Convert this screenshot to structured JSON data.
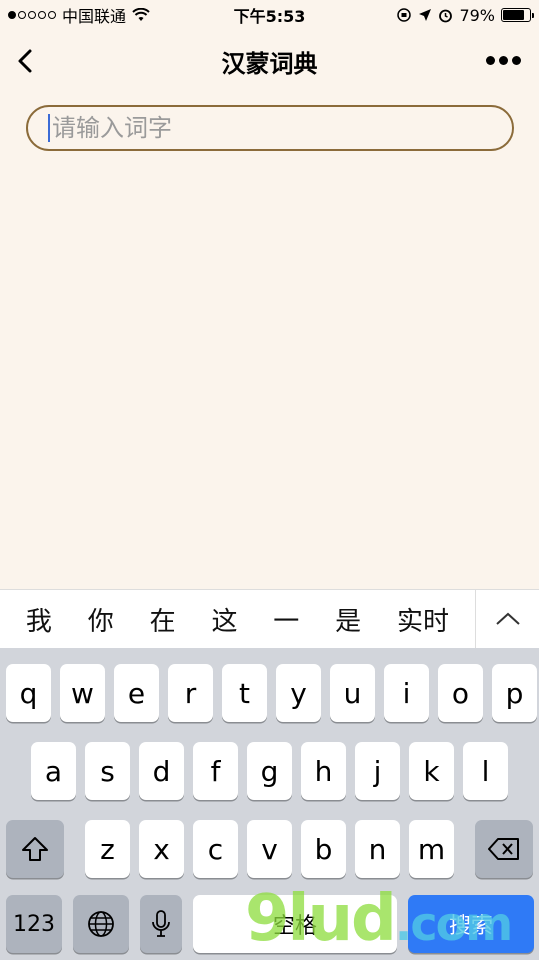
{
  "status_bar": {
    "carrier": "中国联通",
    "time": "下午5:53",
    "battery": "79%",
    "battery_level": 0.79,
    "signal_bars_filled": 1,
    "signal_bars_total": 5
  },
  "nav": {
    "title": "汉蒙词典"
  },
  "search": {
    "placeholder": "请输入词字"
  },
  "candidates": [
    "我",
    "你",
    "在",
    "这",
    "一",
    "是",
    "实时"
  ],
  "keyboard": {
    "row1": [
      "q",
      "w",
      "e",
      "r",
      "t",
      "y",
      "u",
      "i",
      "o",
      "p"
    ],
    "row2": [
      "a",
      "s",
      "d",
      "f",
      "g",
      "h",
      "j",
      "k",
      "l"
    ],
    "row3": [
      "z",
      "x",
      "c",
      "v",
      "b",
      "n",
      "m"
    ],
    "numbers_label": "123",
    "space_label": "空格",
    "search_label": "搜索"
  },
  "watermark": {
    "text": "9lud",
    "suffix": ".com"
  }
}
